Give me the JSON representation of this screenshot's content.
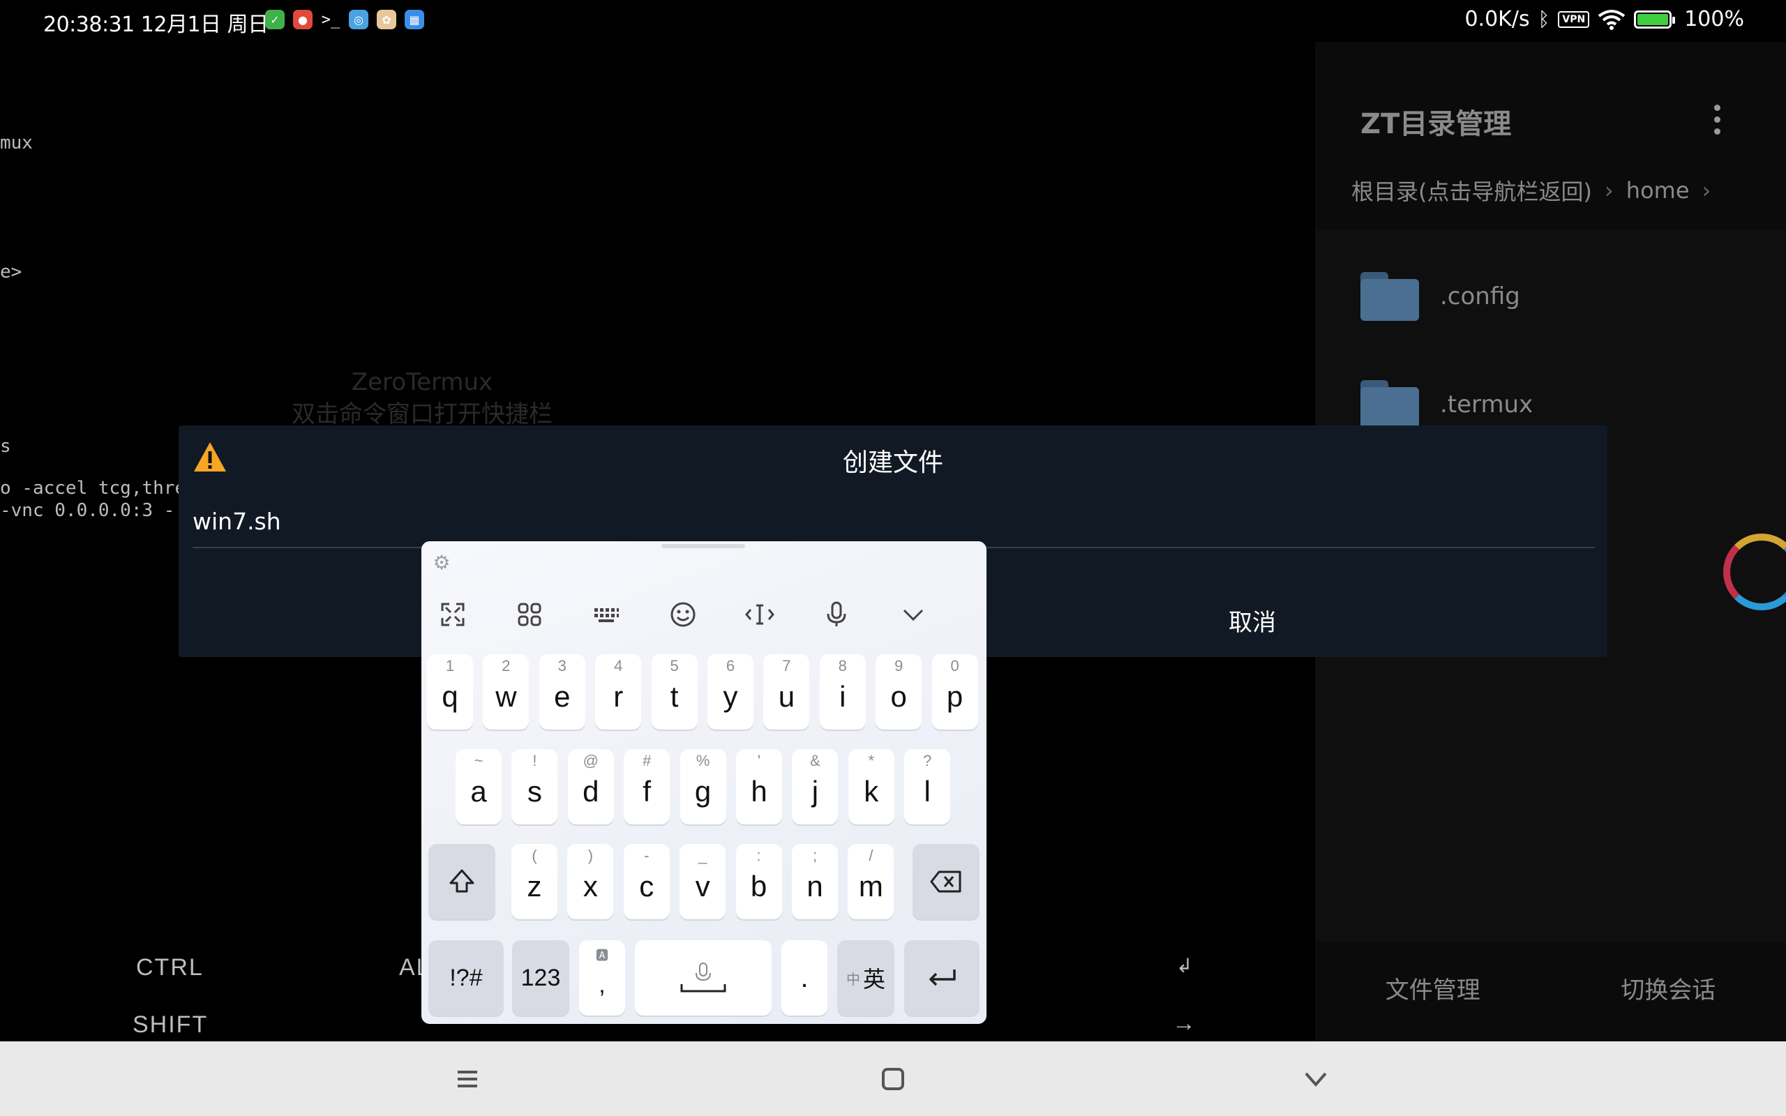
{
  "status_bar": {
    "time": "20:38:31 12月1日 周日",
    "net_speed": "0.0K/s",
    "vpn": "VPN",
    "battery": "100%"
  },
  "terminal": {
    "lines": [
      "mux",
      "e>",
      "s",
      "o -accel tcg,thre",
      "-vnc 0.0.0.0:3 -"
    ],
    "watermark_title": "ZeroTermux",
    "watermark_sub": "双击命令窗口打开快捷栏",
    "extra_keys": {
      "ctrl": "CTRL",
      "alt": "AL",
      "shift": "SHIFT",
      "enter": "↲",
      "arrow": "→"
    }
  },
  "side_panel": {
    "title": "ZT目录管理",
    "breadcrumb": {
      "root": "根目录(点击导航栏返回)",
      "current": "home"
    },
    "items": [
      {
        "label": ".config"
      },
      {
        "label": ".termux"
      }
    ],
    "bottom_tabs": {
      "files": "文件管理",
      "sessions": "切换会话"
    }
  },
  "dialog": {
    "title": "创建文件",
    "input_value": "win7.sh",
    "cancel_label": "取消"
  },
  "keyboard": {
    "row1": [
      {
        "k": "q",
        "s": "1"
      },
      {
        "k": "w",
        "s": "2"
      },
      {
        "k": "e",
        "s": "3"
      },
      {
        "k": "r",
        "s": "4"
      },
      {
        "k": "t",
        "s": "5"
      },
      {
        "k": "y",
        "s": "6"
      },
      {
        "k": "u",
        "s": "7"
      },
      {
        "k": "i",
        "s": "8"
      },
      {
        "k": "o",
        "s": "9"
      },
      {
        "k": "p",
        "s": "0"
      }
    ],
    "row2": [
      {
        "k": "a",
        "s": "~"
      },
      {
        "k": "s",
        "s": "!"
      },
      {
        "k": "d",
        "s": "@"
      },
      {
        "k": "f",
        "s": "#"
      },
      {
        "k": "g",
        "s": "%"
      },
      {
        "k": "h",
        "s": "'"
      },
      {
        "k": "j",
        "s": "&"
      },
      {
        "k": "k",
        "s": "*"
      },
      {
        "k": "l",
        "s": "?"
      }
    ],
    "row3": [
      {
        "k": "z",
        "s": "("
      },
      {
        "k": "x",
        "s": ")"
      },
      {
        "k": "c",
        "s": "-"
      },
      {
        "k": "v",
        "s": "_"
      },
      {
        "k": "b",
        "s": ":"
      },
      {
        "k": "n",
        "s": ";"
      },
      {
        "k": "m",
        "s": "/"
      }
    ],
    "symbols_label": "!?#",
    "numbers_label": "123",
    "comma_label": ",",
    "period_label": ".",
    "lang_label_small": "中",
    "lang_label": "英"
  },
  "icons": {
    "warning": "warning-icon",
    "gear": "gear-icon",
    "shift": "shift-icon",
    "backspace": "backspace-icon",
    "enter": "enter-icon",
    "mic": "microphone-icon"
  },
  "colors": {
    "dialog_bg": "#111a24",
    "warning": "#f5a623",
    "folder": "#4a6f93"
  }
}
